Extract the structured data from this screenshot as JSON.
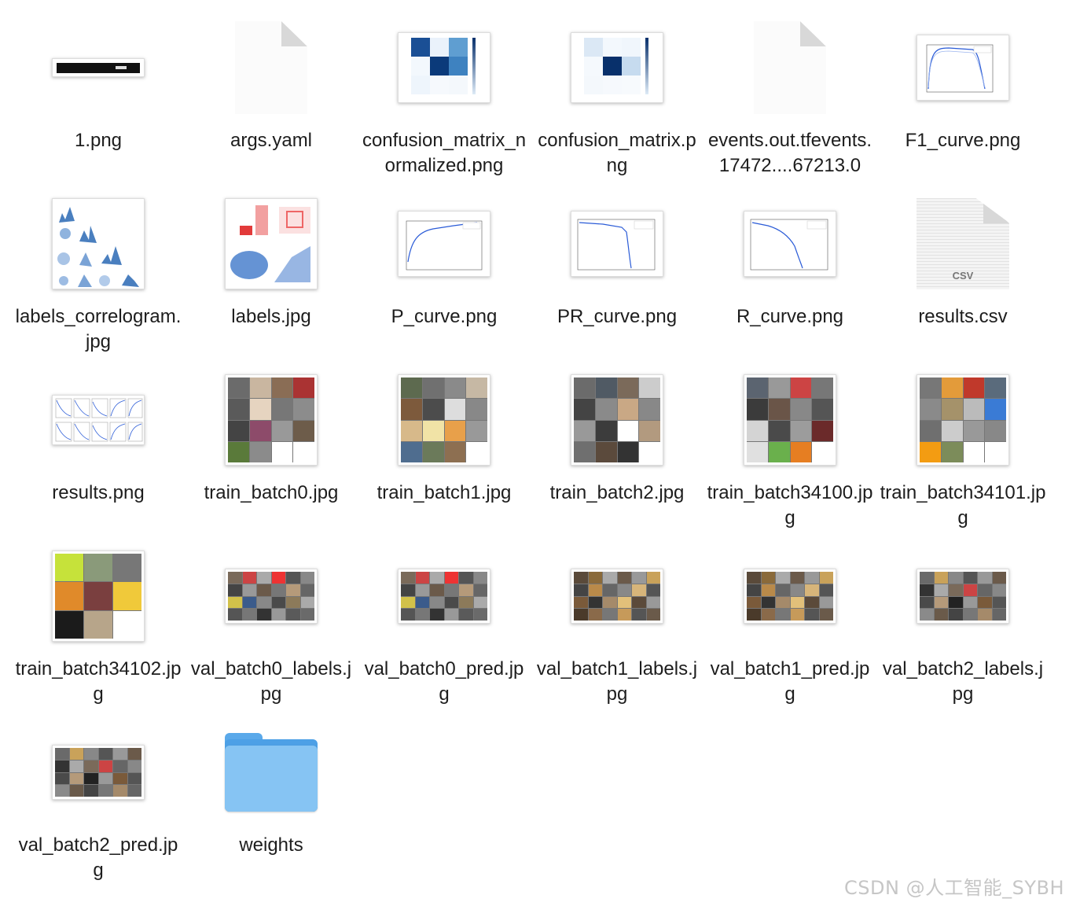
{
  "files": [
    {
      "name": "1.png",
      "icon": "image-thumbnail"
    },
    {
      "name": "args.yaml",
      "icon": "document-icon"
    },
    {
      "name": "confusion_matrix_normalized.png",
      "icon": "image-thumbnail"
    },
    {
      "name": "confusion_matrix.png",
      "icon": "image-thumbnail"
    },
    {
      "name": "events.out.tfevents.17472....67213.0",
      "icon": "document-icon"
    },
    {
      "name": "F1_curve.png",
      "icon": "image-thumbnail"
    },
    {
      "name": "labels_correlogram.jpg",
      "icon": "image-thumbnail"
    },
    {
      "name": "labels.jpg",
      "icon": "image-thumbnail"
    },
    {
      "name": "P_curve.png",
      "icon": "image-thumbnail"
    },
    {
      "name": "PR_curve.png",
      "icon": "image-thumbnail"
    },
    {
      "name": "R_curve.png",
      "icon": "image-thumbnail"
    },
    {
      "name": "results.csv",
      "icon": "csv-icon",
      "badge": "CSV"
    },
    {
      "name": "results.png",
      "icon": "image-thumbnail"
    },
    {
      "name": "train_batch0.jpg",
      "icon": "image-thumbnail"
    },
    {
      "name": "train_batch1.jpg",
      "icon": "image-thumbnail"
    },
    {
      "name": "train_batch2.jpg",
      "icon": "image-thumbnail"
    },
    {
      "name": "train_batch34100.jpg",
      "icon": "image-thumbnail"
    },
    {
      "name": "train_batch34101.jpg",
      "icon": "image-thumbnail"
    },
    {
      "name": "train_batch34102.jpg",
      "icon": "image-thumbnail"
    },
    {
      "name": "val_batch0_labels.jpg",
      "icon": "image-thumbnail"
    },
    {
      "name": "val_batch0_pred.jpg",
      "icon": "image-thumbnail"
    },
    {
      "name": "val_batch1_labels.jpg",
      "icon": "image-thumbnail"
    },
    {
      "name": "val_batch1_pred.jpg",
      "icon": "image-thumbnail"
    },
    {
      "name": "val_batch2_labels.jpg",
      "icon": "image-thumbnail"
    },
    {
      "name": "val_batch2_pred.jpg",
      "icon": "image-thumbnail"
    },
    {
      "name": "weights",
      "icon": "folder-icon"
    }
  ],
  "watermark": "CSDN @人工智能_SYBH",
  "colors": {
    "folder": "#86c4f3",
    "folder_dark": "#4da0e6",
    "matrix_blue": "#08306b",
    "curve_blue": "#2a5bd7"
  }
}
